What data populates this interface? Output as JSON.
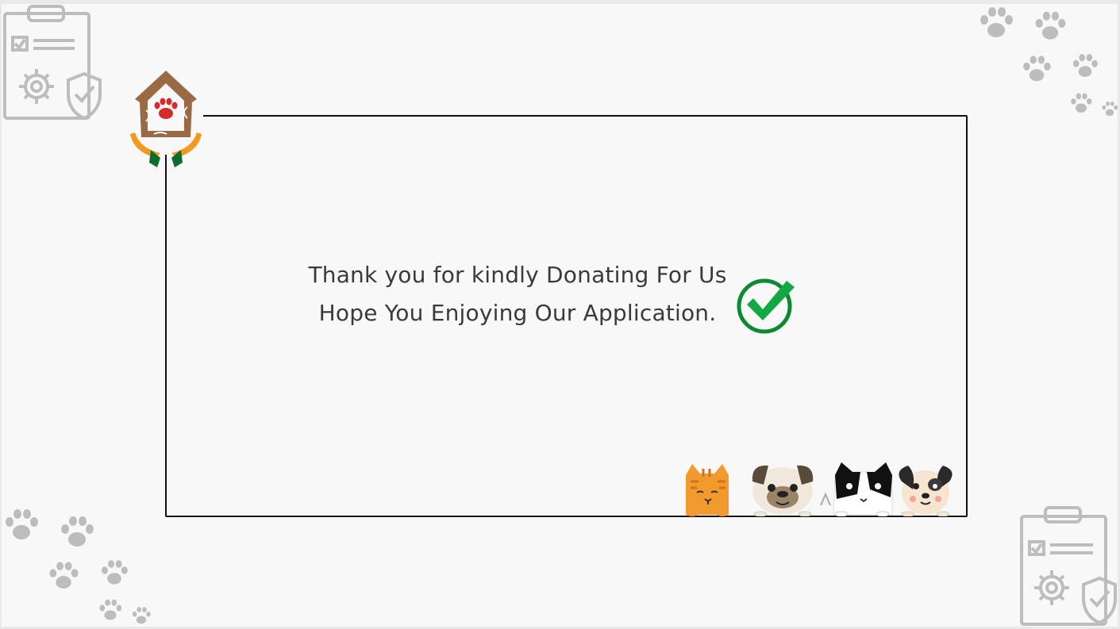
{
  "message": {
    "line1": "Thank you for kindly Donating For Us",
    "line2": "Hope You Enjoying Our Application."
  },
  "icons": {
    "logo": "pet-shelter-logo",
    "success": "check-circle-icon",
    "clipboard": "clipboard-settings-icon",
    "paw": "paw-print-icon",
    "pets": "peeking-pets-illustration"
  },
  "colors": {
    "background": "#f8f8f8",
    "frame": "#111111",
    "text": "#3a3a3a",
    "check": "#0aa23a",
    "decor": "#b8b8b8"
  }
}
